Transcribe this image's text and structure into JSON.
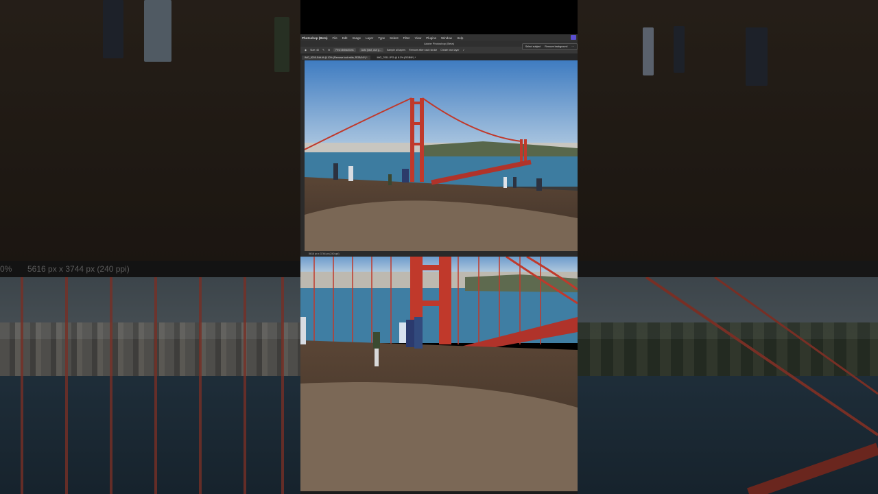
{
  "left_panel": {
    "status_text": "5616 px x 3744 px (240 ppi)",
    "zoom": "0%"
  },
  "photoshop": {
    "app_name": "Photoshop (Beta)",
    "menu": [
      "File",
      "Edit",
      "Image",
      "Layer",
      "Type",
      "Select",
      "Filter",
      "View",
      "Plugins",
      "Window",
      "Help"
    ],
    "window_title": "Adobe Photoshop (Beta)",
    "options": {
      "size_label": "Size: 40",
      "find_distractions": "Find distractions",
      "mode": "Auto (fast, use g...",
      "sample_all_layers": "Sample all layers",
      "remove_after_stroke": "Remove after each stroke",
      "create_new_layer": "Create new layer"
    },
    "tabs": [
      {
        "label": "IMG_8205-Edit.tif @ 10% (Remove tool edits, RGB/16*) *"
      },
      {
        "label": "IMG_7051.JPG @ 8.3% (RGB/8*) *"
      }
    ],
    "contextual_bar": {
      "select_subject": "Select subject",
      "remove_background": "Remove background"
    },
    "status": "5616 px x 3744 px (240 ppi)"
  },
  "colors": {
    "sky_top": "#3f7cc1",
    "sky_bottom": "#b7cee3",
    "bridge": "#c0392b",
    "water": "#3d7ca0",
    "ground": "#4a3a2c"
  }
}
